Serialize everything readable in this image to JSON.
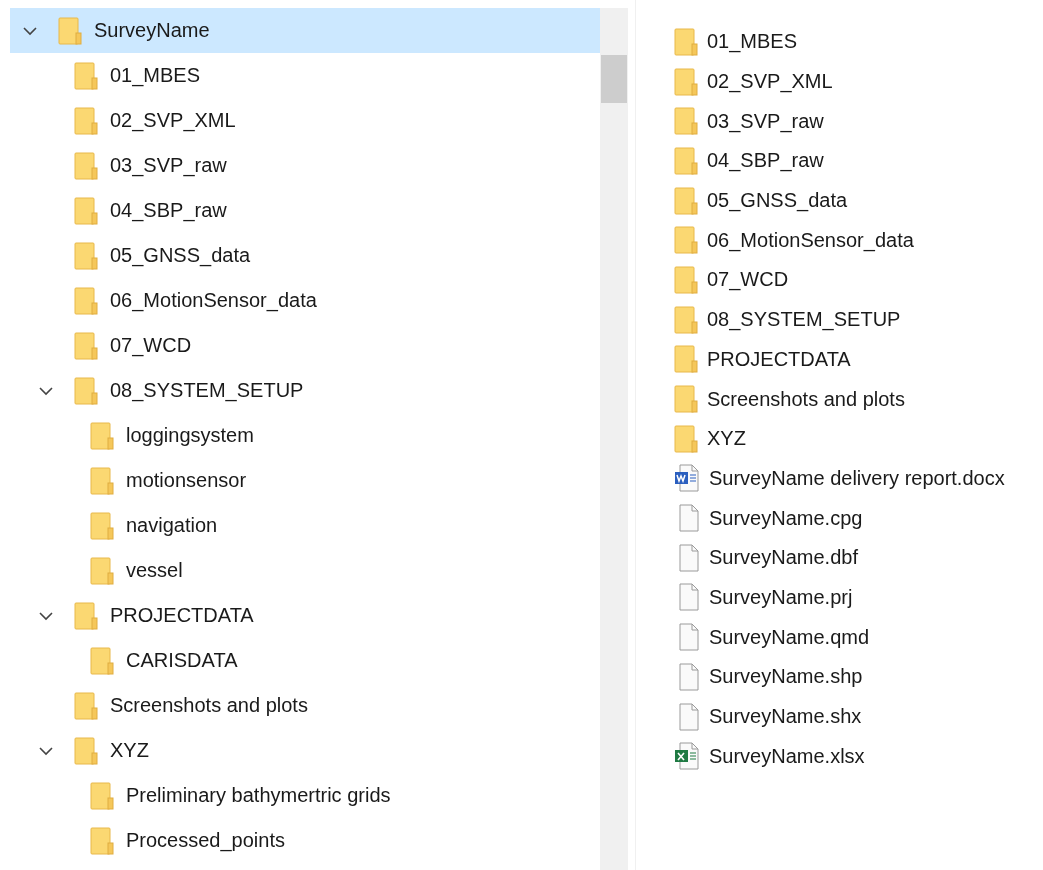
{
  "tree": {
    "items": [
      {
        "label": "SurveyName",
        "selected": true,
        "expanded": true,
        "children": [
          {
            "label": "01_MBES",
            "selected": false
          },
          {
            "label": "02_SVP_XML",
            "selected": false
          },
          {
            "label": "03_SVP_raw",
            "selected": false
          },
          {
            "label": "04_SBP_raw",
            "selected": false
          },
          {
            "label": "05_GNSS_data",
            "selected": false
          },
          {
            "label": "06_MotionSensor_data",
            "selected": false
          },
          {
            "label": "07_WCD",
            "selected": false
          },
          {
            "label": "08_SYSTEM_SETUP",
            "selected": false,
            "expanded": true,
            "children": [
              {
                "label": "loggingsystem",
                "selected": false
              },
              {
                "label": "motionsensor",
                "selected": false
              },
              {
                "label": "navigation",
                "selected": false
              },
              {
                "label": "vessel",
                "selected": false
              }
            ]
          },
          {
            "label": "PROJECTDATA",
            "selected": false,
            "expanded": true,
            "children": [
              {
                "label": "CARISDATA",
                "selected": false
              }
            ]
          },
          {
            "label": "Screenshots and plots",
            "selected": false
          },
          {
            "label": "XYZ",
            "selected": false,
            "expanded": true,
            "children": [
              {
                "label": "Preliminary bathymertric grids",
                "selected": false
              },
              {
                "label": "Processed_points",
                "selected": false
              }
            ]
          }
        ]
      }
    ]
  },
  "files": [
    {
      "name": "01_MBES",
      "kind": "folder"
    },
    {
      "name": "02_SVP_XML",
      "kind": "folder"
    },
    {
      "name": "03_SVP_raw",
      "kind": "folder"
    },
    {
      "name": "04_SBP_raw",
      "kind": "folder"
    },
    {
      "name": "05_GNSS_data",
      "kind": "folder"
    },
    {
      "name": "06_MotionSensor_data",
      "kind": "folder"
    },
    {
      "name": "07_WCD",
      "kind": "folder"
    },
    {
      "name": "08_SYSTEM_SETUP",
      "kind": "folder"
    },
    {
      "name": "PROJECTDATA",
      "kind": "folder"
    },
    {
      "name": "Screenshots and plots",
      "kind": "folder"
    },
    {
      "name": "XYZ",
      "kind": "folder"
    },
    {
      "name": "SurveyName delivery report.docx",
      "kind": "word"
    },
    {
      "name": "SurveyName.cpg",
      "kind": "file"
    },
    {
      "name": "SurveyName.dbf",
      "kind": "file"
    },
    {
      "name": "SurveyName.prj",
      "kind": "file"
    },
    {
      "name": "SurveyName.qmd",
      "kind": "file"
    },
    {
      "name": "SurveyName.shp",
      "kind": "file"
    },
    {
      "name": "SurveyName.shx",
      "kind": "file"
    },
    {
      "name": "SurveyName.xlsx",
      "kind": "excel"
    }
  ]
}
